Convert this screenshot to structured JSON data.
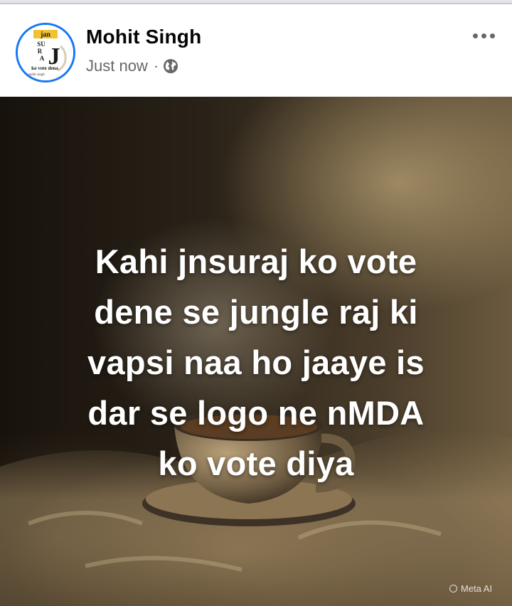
{
  "post": {
    "author": "Mohit Singh",
    "timestamp": "Just now",
    "separator": "·",
    "audience_icon": "globe-icon",
    "more_icon": "more-options-icon"
  },
  "avatar": {
    "badge_text": "jan",
    "letters": [
      "SU",
      "R",
      "A",
      "J"
    ],
    "caption": "ko vote dena",
    "signature": "mohit singh"
  },
  "image": {
    "lines": [
      "Kahi jnsuraj ko vote",
      "dene se jungle raj ki",
      "vapsi naa ho jaaye is",
      "dar se logo ne nMDA",
      "ko vote diya"
    ],
    "watermark": "Meta AI"
  },
  "colors": {
    "accent": "#1877f2",
    "name_text": "#050505",
    "meta_text": "#65676b"
  }
}
